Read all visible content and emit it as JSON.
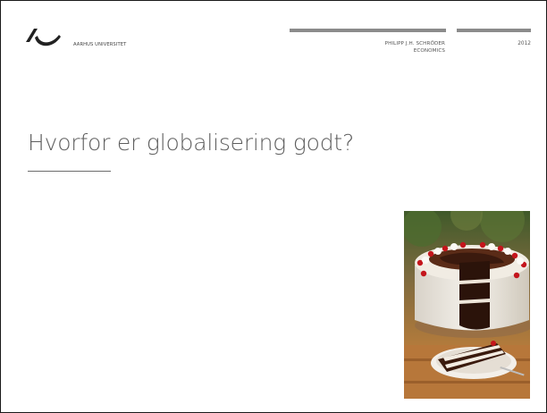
{
  "header": {
    "institution": "AARHUS UNIVERSITET",
    "author_line1": "PHILIPP J.H. SCHRÖDER",
    "author_line2": "ECONOMICS",
    "year": "2012"
  },
  "slide": {
    "title": "Hvorfor er globalisering godt?"
  },
  "image": {
    "subject": "black-forest-cake-photo"
  },
  "colors": {
    "title_text": "#5e5e5e",
    "header_rule": "#8b8b8b",
    "frame": "#1a1a1a"
  }
}
